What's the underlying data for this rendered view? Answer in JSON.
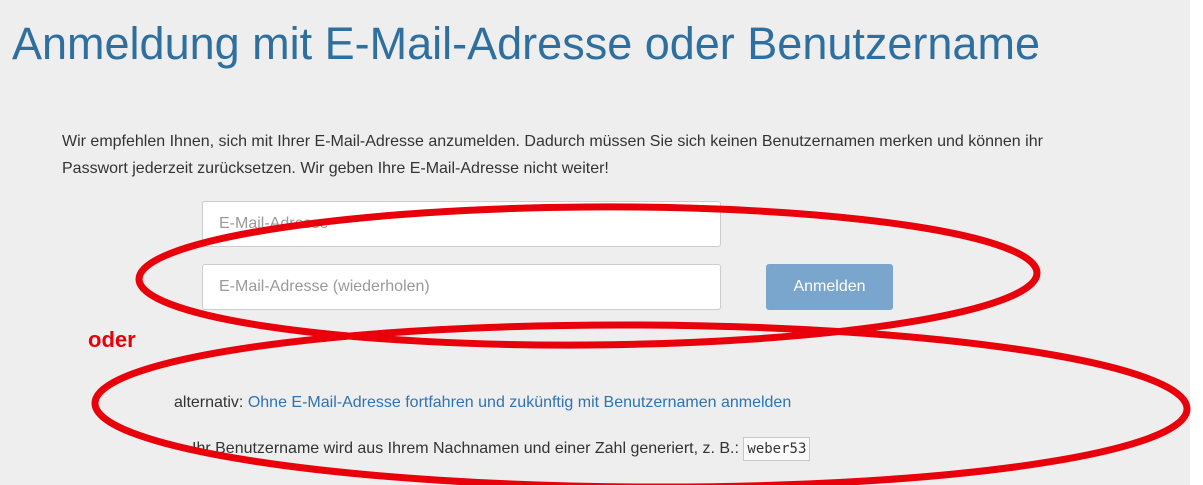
{
  "header": {
    "title": "Anmeldung mit E-Mail-Adresse oder Benutzername"
  },
  "intro": {
    "text": "Wir empfehlen Ihnen, sich mit Ihrer E-Mail-Adresse anzumelden. Dadurch müssen Sie sich keinen Benutzernamen merken und können ihr Passwort jederzeit zurücksetzen. Wir geben Ihre E-Mail-Adresse nicht weiter!"
  },
  "form": {
    "email": {
      "value": "",
      "placeholder": "E-Mail-Adresse"
    },
    "email_repeat": {
      "value": "",
      "placeholder": "E-Mail-Adresse (wiederholen)"
    },
    "submit_label": "Anmelden"
  },
  "annotation": {
    "oder_label": "oder",
    "color": "#e8000b"
  },
  "alternative": {
    "prefix": "alternativ:",
    "link_text": "Ohne E-Mail-Adresse fortfahren und zukünftig mit Benutzernamen anmelden",
    "username_hint": "Ihr Benutzername wird aus Ihrem Nachnamen und einer Zahl generiert, z. B.:",
    "example": "weber53"
  },
  "colors": {
    "title": "#2f6f9f",
    "link": "#2f73b1",
    "button": "#7aa6cd",
    "background": "#eeeeee"
  }
}
